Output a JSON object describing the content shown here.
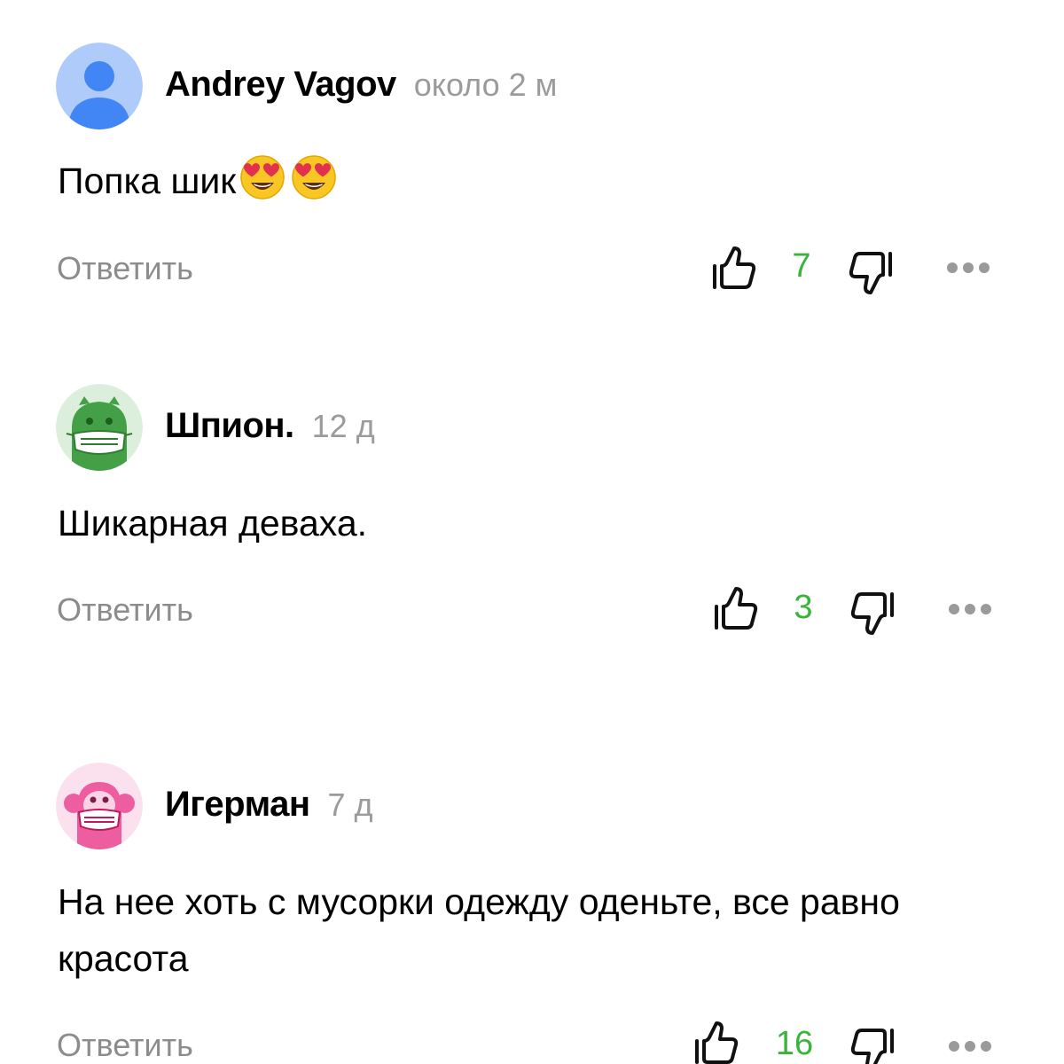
{
  "colors": {
    "like_count": "#3bb33b",
    "muted_text": "#8c8c8c",
    "timestamp": "#9b9b9b"
  },
  "comments": [
    {
      "author": "Andrey Vagov",
      "time": "около 2 м",
      "avatar": "default-user-avatar",
      "text": "Попка шик",
      "emojis": [
        "heart-eyes-emoji",
        "heart-eyes-emoji"
      ],
      "reply_label": "Ответить",
      "likes": "7"
    },
    {
      "author": "Шпион.",
      "time": "12 д",
      "avatar": "green-monster-mask-avatar",
      "text": "Шикарная деваха.",
      "reply_label": "Ответить",
      "likes": "3"
    },
    {
      "author": "Игерман",
      "time": "7 д",
      "avatar": "pink-monkey-mask-avatar",
      "text": "На нее хоть с мусорки одежду оденьте, все равно красота",
      "reply_label": "Ответить",
      "likes": "16"
    }
  ]
}
